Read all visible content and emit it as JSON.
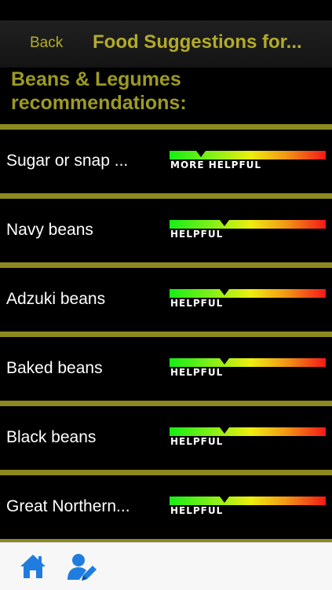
{
  "nav": {
    "back_label": "Back",
    "title": "Food Suggestions for..."
  },
  "section": {
    "heading_line1": "Beans & Legumes",
    "heading_line2": "recommendations:"
  },
  "items": [
    {
      "name": "Sugar or snap ...",
      "rating": "MORE HELPFUL",
      "level": 0.2
    },
    {
      "name": "Navy beans",
      "rating": "HELPFUL",
      "level": 0.35
    },
    {
      "name": "Adzuki beans",
      "rating": "HELPFUL",
      "level": 0.35
    },
    {
      "name": "Baked beans",
      "rating": "HELPFUL",
      "level": 0.35
    },
    {
      "name": "Black beans",
      "rating": "HELPFUL",
      "level": 0.35
    },
    {
      "name": "Great Northern...",
      "rating": "HELPFUL",
      "level": 0.35
    }
  ],
  "tabs": [
    {
      "icon": "home-icon"
    },
    {
      "icon": "edit-profile-icon"
    }
  ],
  "colors": {
    "accent": "#b3ab2a",
    "divider": "#8c8a1e",
    "tab_icon": "#1f7de0"
  }
}
